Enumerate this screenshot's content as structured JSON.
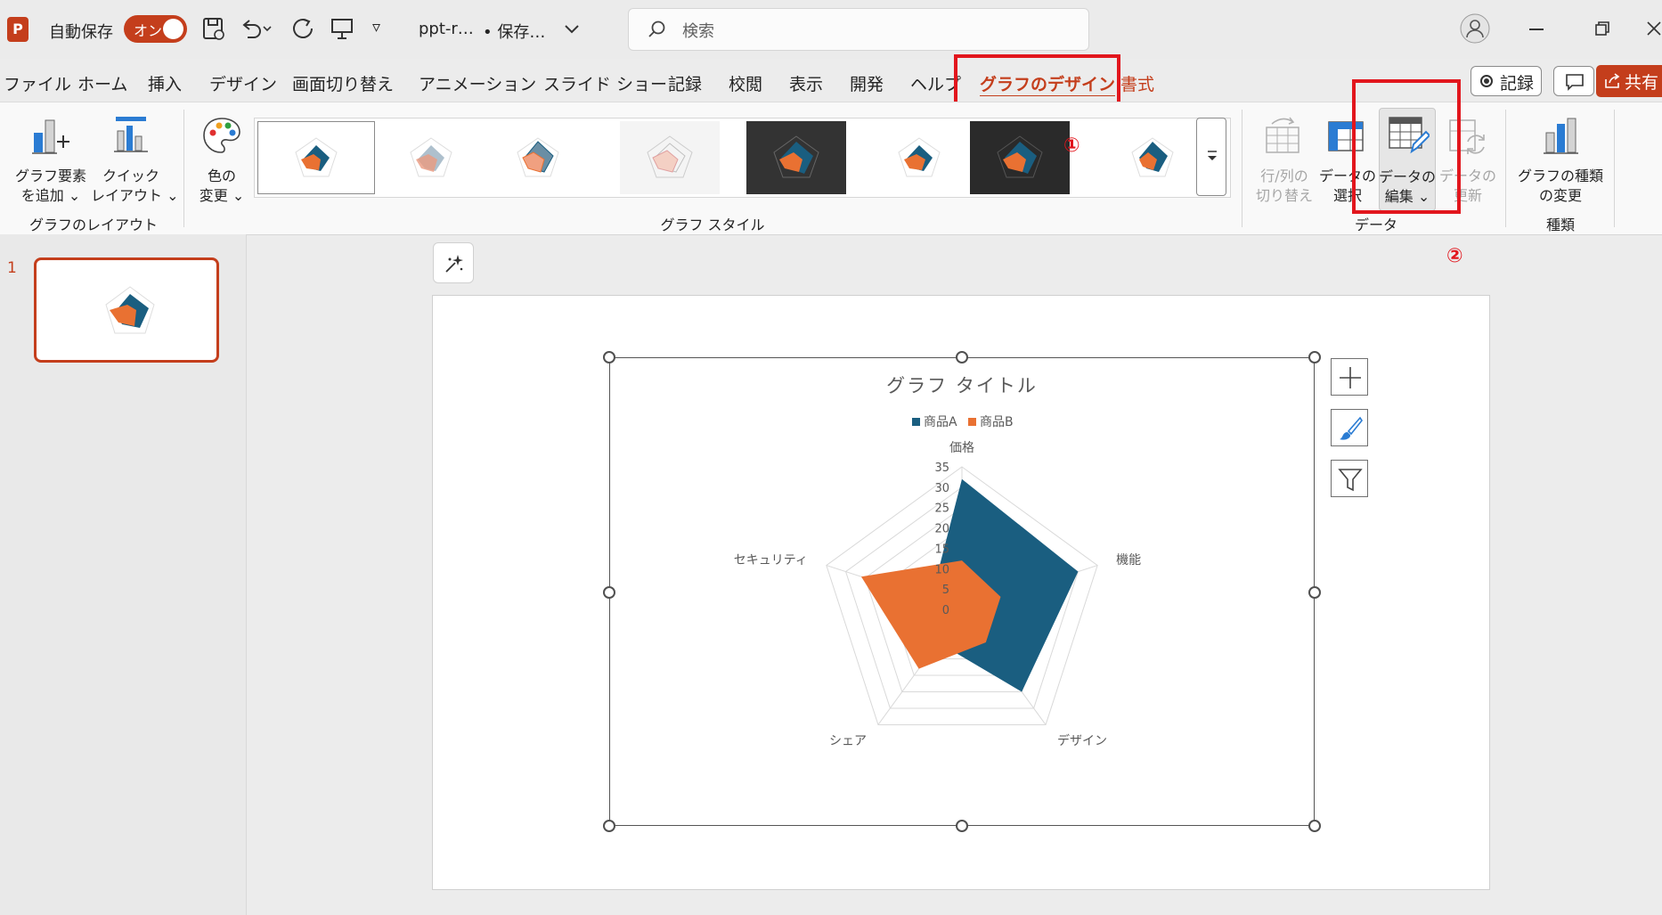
{
  "title_bar": {
    "app_icon": "powerpoint-icon",
    "autosave_label": "自動保存",
    "autosave_state": "オン",
    "filename": "ppt-r…",
    "save_status": "• 保存…",
    "search_placeholder": "検索"
  },
  "tabs": [
    "ファイル",
    "ホーム",
    "挿入",
    "デザイン",
    "画面切り替え",
    "アニメーション",
    "スライド ショー",
    "記録",
    "校閲",
    "表示",
    "開発",
    "ヘルプ"
  ],
  "active_tab": "グラフのデザイン",
  "format_tab": "書式",
  "top_right": {
    "record_label": "記録",
    "share_label": "共有"
  },
  "ribbon": {
    "add_element": [
      "グラフ要素",
      "を追加 ⌄"
    ],
    "quick_layout": [
      "クイック",
      "レイアウト ⌄"
    ],
    "layout_group": "グラフのレイアウト",
    "change_colors": [
      "色の",
      "変更 ⌄"
    ],
    "style_group": "グラフ スタイル",
    "switch_row_col": [
      "行/列の",
      "切り替え"
    ],
    "select_data": [
      "データの",
      "選択"
    ],
    "edit_data": [
      "データの",
      "編集 ⌄"
    ],
    "refresh_data": [
      "データの",
      "更新"
    ],
    "data_group": "データ",
    "change_type": [
      "グラフの種類",
      "の変更"
    ],
    "type_group": "種類"
  },
  "annotations": {
    "step1": "①",
    "step2": "②"
  },
  "slide_panel": {
    "slide_number": "1"
  },
  "colors": {
    "accent": "#c43e1c",
    "series_a": "#1a5e80",
    "series_b": "#e97132",
    "annotation_red": "#e2161d"
  },
  "chart_data": {
    "type": "radar",
    "title": "グラフ タイトル",
    "categories": [
      "価格",
      "機能",
      "デザイン",
      "シェア",
      "セキュリティ"
    ],
    "series": [
      {
        "name": "商品A",
        "values": [
          32,
          30,
          25,
          10,
          8
        ]
      },
      {
        "name": "商品B",
        "values": [
          12,
          10,
          10,
          18,
          26
        ]
      }
    ],
    "rlim": [
      0,
      35
    ],
    "ticks": [
      "0",
      "5",
      "10",
      "15",
      "20",
      "25",
      "30",
      "35"
    ],
    "legend": "top"
  }
}
